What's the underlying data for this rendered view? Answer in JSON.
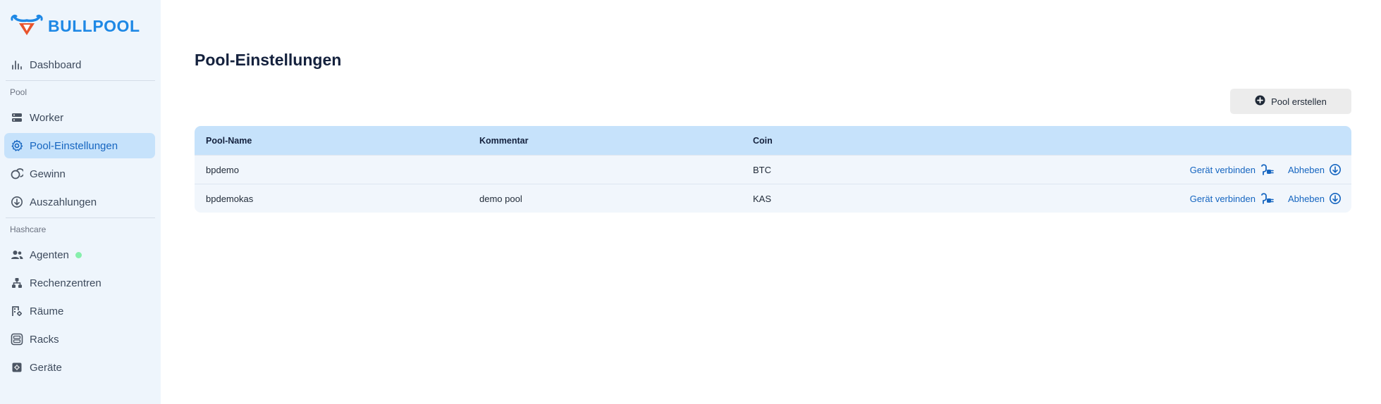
{
  "brand": {
    "name": "BULLPOOL"
  },
  "sidebar": {
    "dashboard": "Dashboard",
    "section_pool": "Pool",
    "pool_items": [
      "Worker",
      "Pool-Einstellungen",
      "Gewinn",
      "Auszahlungen"
    ],
    "section_hashcare": "Hashcare",
    "hashcare_items": [
      "Agenten",
      "Rechenzentren",
      "Räume",
      "Racks",
      "Geräte"
    ],
    "active": "Pool-Einstellungen"
  },
  "main": {
    "title": "Pool-Einstellungen",
    "create_button": "Pool erstellen",
    "table": {
      "headers": [
        "Pool-Name",
        "Kommentar",
        "Coin"
      ],
      "rows": [
        {
          "name": "bpdemo",
          "comment": "",
          "coin": "BTC"
        },
        {
          "name": "bpdemokas",
          "comment": "demo pool",
          "coin": "KAS"
        }
      ],
      "action_connect": "Gerät verbinden",
      "action_withdraw": "Abheben"
    }
  },
  "colors": {
    "accent": "#1565c0",
    "brand": "#1e88e5",
    "logo_orange": "#e8542c",
    "active_bg": "#c6e2fb",
    "sidebar_bg": "#eef5fc",
    "status_online": "#86efac"
  }
}
